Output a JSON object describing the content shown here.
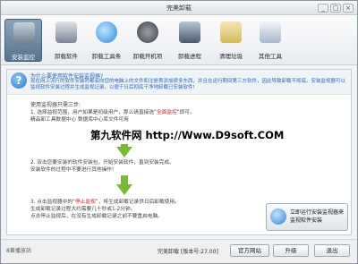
{
  "window": {
    "title": "完美卸载",
    "controls": {
      "minimize": "_",
      "maximize": "□",
      "close": "×"
    }
  },
  "toolbar": {
    "items": [
      {
        "label": "安装监控",
        "icon": "camera-icon",
        "color": "#6d7f90",
        "active": true
      },
      {
        "label": "卸载软件",
        "icon": "hard-drive-icon",
        "color": "#7b8794"
      },
      {
        "label": "卸载工具条",
        "icon": "ie-logo-icon",
        "color": "#2f86d8"
      },
      {
        "label": "卸载开机项",
        "icon": "speaker-icon",
        "color": "#3e3e44"
      },
      {
        "label": "卸载进程",
        "icon": "process-screen-icon",
        "color": "#4a5b6f"
      },
      {
        "label": "清理垃圾",
        "icon": "broom-icon",
        "color": "#d3b85c"
      },
      {
        "label": "其他工具",
        "icon": "tools-grid-icon",
        "color": "#a8b7c8"
      }
    ]
  },
  "intro": {
    "question": "为什么要使用软件安装监视器?",
    "answer": "现在网上流行的软件安装时都会向您的电脑上的文件和注册表添加很多东西，并且在运行期间第三方软件，因此导致卸载不彻底。安装监视器可以监视软件安装过程并生成监视记录，以便于日后彻底干净地卸载已安装软件!"
  },
  "steps": {
    "heading": "使用监视器只需三步:",
    "s1_a": "1. 选择监视范围，用户如果是初级用户，那么请直接选“",
    "s1_hl": "全面监控",
    "s1_b": "”即可。",
    "s1_line2": "精品卸工具数据中心 数据库中心库文件可用",
    "s2_line1": "2. 双击您要安装的软件安装包，开始安装软件，直到安装完成。",
    "s2_line2": "安装软件的过程中不要进行其他操作!",
    "s3_a": "3. 点击监视器中的“",
    "s3_hl": "停止监视",
    "s3_b": "”，将生成卸载记录供日后卸载使用。",
    "s3_line2": "生成卸载记录过程大约需要几十秒或1-2分钟。",
    "s3_line3": "点击停止监视后，在没有生成卸载记录之前不要重启电脑。"
  },
  "watermark": {
    "text": "第九软件网 http://Www.D9soft.COM"
  },
  "start_button": {
    "label": "立即运行安装监视器来监视软件安装"
  },
  "statusbar": {
    "left_text": "8黄播放站",
    "version": "完美卸载 [版本号:27.00]",
    "official_site": "官方网站",
    "upgrade": "升级",
    "exit": "退出"
  }
}
